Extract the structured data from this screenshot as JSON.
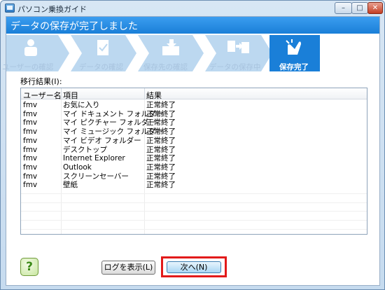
{
  "window": {
    "title": "パソコン乗換ガイド",
    "controls": {
      "minimize": "–",
      "maximize": "□",
      "close": "✕"
    }
  },
  "header": {
    "title": "データの保存が完了しました"
  },
  "steps": [
    {
      "label": "ユーザーの確認",
      "icon": "user-icon",
      "active": false
    },
    {
      "label": "データの確認",
      "icon": "document-check-icon",
      "active": false
    },
    {
      "label": "保存先の確認",
      "icon": "save-destination-icon",
      "active": false
    },
    {
      "label": "データの保存中",
      "icon": "copy-icon",
      "active": false
    },
    {
      "label": "保存完了",
      "icon": "clapping-hands-icon",
      "active": true
    }
  ],
  "result": {
    "label": "移行結果(I):",
    "columns": [
      "ユーザー名",
      "項目",
      "結果"
    ],
    "rows": [
      {
        "user": "fmv",
        "item": "お気に入り",
        "status": "正常終了"
      },
      {
        "user": "fmv",
        "item": "マイ ドキュメント フォルダー",
        "status": "正常終了"
      },
      {
        "user": "fmv",
        "item": "マイ ピクチャー フォルダー",
        "status": "正常終了"
      },
      {
        "user": "fmv",
        "item": "マイ ミュージック フォルダー",
        "status": "正常終了"
      },
      {
        "user": "fmv",
        "item": "マイ ビデオ フォルダー",
        "status": "正常終了"
      },
      {
        "user": "fmv",
        "item": "デスクトップ",
        "status": "正常終了"
      },
      {
        "user": "fmv",
        "item": "Internet Explorer",
        "status": "正常終了"
      },
      {
        "user": "fmv",
        "item": "Outlook",
        "status": "正常終了"
      },
      {
        "user": "fmv",
        "item": "スクリーンセーバー",
        "status": "正常終了"
      },
      {
        "user": "fmv",
        "item": "壁紙",
        "status": "正常終了"
      }
    ]
  },
  "footer": {
    "help_label": "?",
    "log_button": "ログを表示(L)",
    "next_button": "次へ(N)"
  },
  "colors": {
    "header": "#1a7fd8",
    "step_inactive": "#bcd8f0",
    "step_active": "#1a7fd8",
    "highlight": "#e21a1a"
  }
}
